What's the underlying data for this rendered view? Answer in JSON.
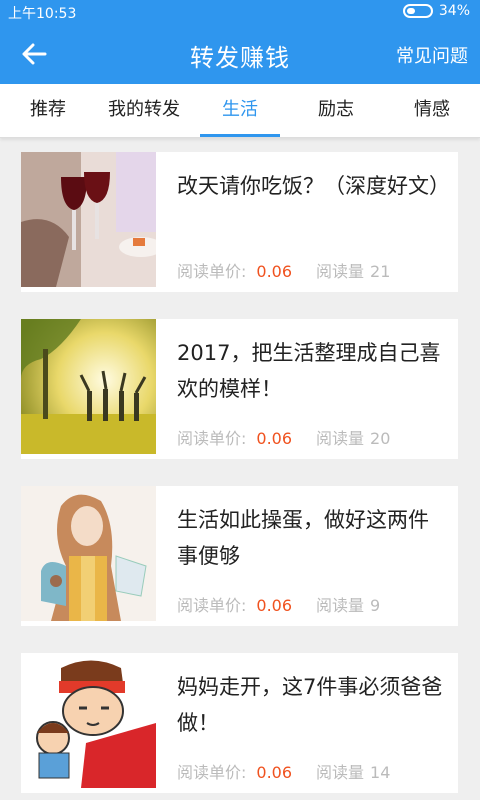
{
  "status": {
    "time": "上午10:53",
    "battery": "34%"
  },
  "header": {
    "title": "转发赚钱",
    "faq": "常见问题"
  },
  "tabs": [
    {
      "label": "推荐",
      "active": false
    },
    {
      "label": "我的转发",
      "active": false
    },
    {
      "label": "生活",
      "active": true
    },
    {
      "label": "励志",
      "active": false
    },
    {
      "label": "情感",
      "active": false
    }
  ],
  "meta_labels": {
    "price": "阅读单价:",
    "reads": "阅读量"
  },
  "articles": [
    {
      "title": "改天请你吃饭？（深度好文）",
      "price": "0.06",
      "reads": "21",
      "image": "wine-glasses"
    },
    {
      "title": "2017，把生活整理成自己喜欢的模样！",
      "price": "0.06",
      "reads": "20",
      "image": "people-under-tree-sunlight"
    },
    {
      "title": "生活如此操蛋，做好这两件事便够",
      "price": "0.06",
      "reads": "9",
      "image": "illustrated-girl"
    },
    {
      "title": "妈妈走开，这7件事必须爸爸做！",
      "price": "0.06",
      "reads": "14",
      "image": "cartoon-father-child"
    }
  ],
  "colors": {
    "brand": "#2f96ee",
    "price": "#f0521f"
  }
}
